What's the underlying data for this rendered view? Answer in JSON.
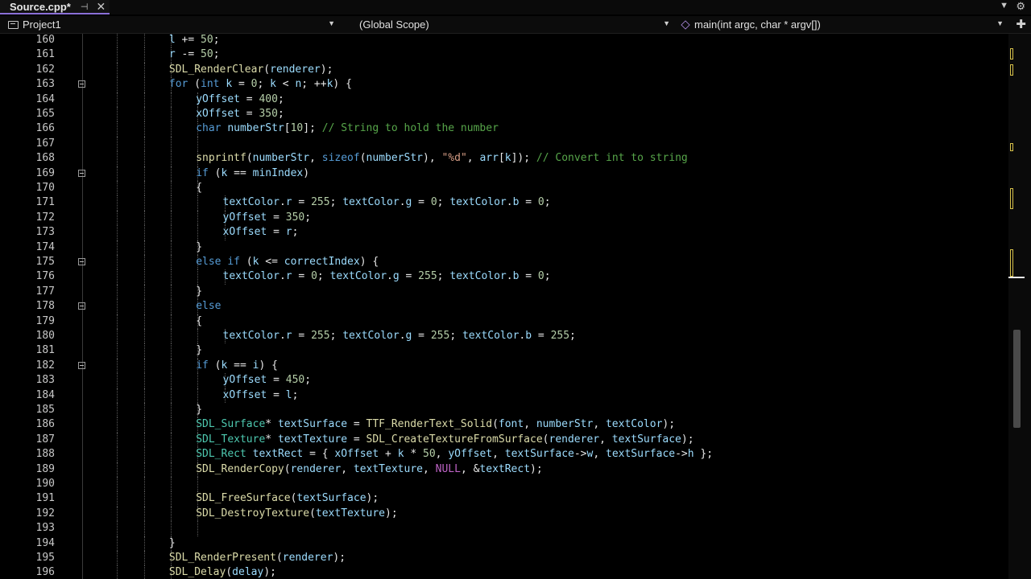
{
  "tab": {
    "title": "Source.cpp*",
    "pin_icon": "pin-icon",
    "close_icon": "close-icon"
  },
  "navbar": {
    "project": "Project1",
    "scope": "(Global Scope)",
    "function": "main(int argc, char * argv[])"
  },
  "colors": {
    "keyword": "#569cd6",
    "type": "#4ec9b0",
    "function": "#dcdcaa",
    "comment": "#57a64a",
    "string": "#d69d85",
    "number": "#b5cea8",
    "variable": "#9cdcfe",
    "macro": "#bd63c5",
    "plain": "#e6e6e6"
  },
  "lines": [
    {
      "n": "160",
      "indent": 4,
      "tokens": [
        [
          "v",
          "l"
        ],
        [
          "p",
          " += "
        ],
        [
          "num",
          "50"
        ],
        [
          "p",
          ";"
        ]
      ]
    },
    {
      "n": "161",
      "indent": 4,
      "tokens": [
        [
          "v",
          "r"
        ],
        [
          "p",
          " -= "
        ],
        [
          "num",
          "50"
        ],
        [
          "p",
          ";"
        ]
      ]
    },
    {
      "n": "162",
      "indent": 4,
      "tokens": [
        [
          "f",
          "SDL_RenderClear"
        ],
        [
          "p",
          "("
        ],
        [
          "v",
          "renderer"
        ],
        [
          "p",
          ");"
        ]
      ]
    },
    {
      "n": "163",
      "indent": 4,
      "fold": true,
      "tokens": [
        [
          "kw",
          "for"
        ],
        [
          "p",
          " ("
        ],
        [
          "kw",
          "int"
        ],
        [
          "p",
          " "
        ],
        [
          "v",
          "k"
        ],
        [
          "p",
          " = "
        ],
        [
          "num",
          "0"
        ],
        [
          "p",
          "; "
        ],
        [
          "v",
          "k"
        ],
        [
          "p",
          " < "
        ],
        [
          "v",
          "n"
        ],
        [
          "p",
          "; ++"
        ],
        [
          "v",
          "k"
        ],
        [
          "p",
          ") {"
        ]
      ]
    },
    {
      "n": "164",
      "indent": 5,
      "tokens": [
        [
          "v",
          "yOffset"
        ],
        [
          "p",
          " = "
        ],
        [
          "num",
          "400"
        ],
        [
          "p",
          ";"
        ]
      ]
    },
    {
      "n": "165",
      "indent": 5,
      "tokens": [
        [
          "v",
          "xOffset"
        ],
        [
          "p",
          " = "
        ],
        [
          "num",
          "350"
        ],
        [
          "p",
          ";"
        ]
      ]
    },
    {
      "n": "166",
      "indent": 5,
      "tokens": [
        [
          "kw",
          "char"
        ],
        [
          "p",
          " "
        ],
        [
          "v",
          "numberStr"
        ],
        [
          "p",
          "["
        ],
        [
          "num",
          "10"
        ],
        [
          "p",
          "]; "
        ],
        [
          "c",
          "// String to hold the number"
        ]
      ]
    },
    {
      "n": "167",
      "indent": 5,
      "tokens": []
    },
    {
      "n": "168",
      "indent": 5,
      "tokens": [
        [
          "f",
          "snprintf"
        ],
        [
          "p",
          "("
        ],
        [
          "v",
          "numberStr"
        ],
        [
          "p",
          ", "
        ],
        [
          "kw",
          "sizeof"
        ],
        [
          "p",
          "("
        ],
        [
          "v",
          "numberStr"
        ],
        [
          "p",
          "), "
        ],
        [
          "s",
          "\"%d\""
        ],
        [
          "p",
          ", "
        ],
        [
          "v",
          "arr"
        ],
        [
          "p",
          "["
        ],
        [
          "v",
          "k"
        ],
        [
          "p",
          "]); "
        ],
        [
          "c",
          "// Convert int to string"
        ]
      ]
    },
    {
      "n": "169",
      "indent": 5,
      "fold": true,
      "tokens": [
        [
          "kw",
          "if"
        ],
        [
          "p",
          " ("
        ],
        [
          "v",
          "k"
        ],
        [
          "p",
          " == "
        ],
        [
          "v",
          "minIndex"
        ],
        [
          "p",
          ")"
        ]
      ]
    },
    {
      "n": "170",
      "indent": 5,
      "tokens": [
        [
          "p",
          "{"
        ]
      ]
    },
    {
      "n": "171",
      "indent": 6,
      "tokens": [
        [
          "v",
          "textColor"
        ],
        [
          "p",
          "."
        ],
        [
          "v",
          "r"
        ],
        [
          "p",
          " = "
        ],
        [
          "num",
          "255"
        ],
        [
          "p",
          "; "
        ],
        [
          "v",
          "textColor"
        ],
        [
          "p",
          "."
        ],
        [
          "v",
          "g"
        ],
        [
          "p",
          " = "
        ],
        [
          "num",
          "0"
        ],
        [
          "p",
          "; "
        ],
        [
          "v",
          "textColor"
        ],
        [
          "p",
          "."
        ],
        [
          "v",
          "b"
        ],
        [
          "p",
          " = "
        ],
        [
          "num",
          "0"
        ],
        [
          "p",
          ";"
        ]
      ]
    },
    {
      "n": "172",
      "indent": 6,
      "tokens": [
        [
          "v",
          "yOffset"
        ],
        [
          "p",
          " = "
        ],
        [
          "num",
          "350"
        ],
        [
          "p",
          ";"
        ]
      ]
    },
    {
      "n": "173",
      "indent": 6,
      "tokens": [
        [
          "v",
          "xOffset"
        ],
        [
          "p",
          " = "
        ],
        [
          "v",
          "r"
        ],
        [
          "p",
          ";"
        ]
      ]
    },
    {
      "n": "174",
      "indent": 5,
      "tokens": [
        [
          "p",
          "}"
        ]
      ]
    },
    {
      "n": "175",
      "indent": 5,
      "fold": true,
      "tokens": [
        [
          "kw",
          "else if"
        ],
        [
          "p",
          " ("
        ],
        [
          "v",
          "k"
        ],
        [
          "p",
          " <= "
        ],
        [
          "v",
          "correctIndex"
        ],
        [
          "p",
          ") {"
        ]
      ]
    },
    {
      "n": "176",
      "indent": 6,
      "tokens": [
        [
          "v",
          "textColor"
        ],
        [
          "p",
          "."
        ],
        [
          "v",
          "r"
        ],
        [
          "p",
          " = "
        ],
        [
          "num",
          "0"
        ],
        [
          "p",
          "; "
        ],
        [
          "v",
          "textColor"
        ],
        [
          "p",
          "."
        ],
        [
          "v",
          "g"
        ],
        [
          "p",
          " = "
        ],
        [
          "num",
          "255"
        ],
        [
          "p",
          "; "
        ],
        [
          "v",
          "textColor"
        ],
        [
          "p",
          "."
        ],
        [
          "v",
          "b"
        ],
        [
          "p",
          " = "
        ],
        [
          "num",
          "0"
        ],
        [
          "p",
          ";"
        ]
      ]
    },
    {
      "n": "177",
      "indent": 5,
      "tokens": [
        [
          "p",
          "}"
        ]
      ]
    },
    {
      "n": "178",
      "indent": 5,
      "fold": true,
      "tokens": [
        [
          "kw",
          "else"
        ]
      ]
    },
    {
      "n": "179",
      "indent": 5,
      "tokens": [
        [
          "p",
          "{"
        ]
      ]
    },
    {
      "n": "180",
      "indent": 6,
      "tokens": [
        [
          "v",
          "textColor"
        ],
        [
          "p",
          "."
        ],
        [
          "v",
          "r"
        ],
        [
          "p",
          " = "
        ],
        [
          "num",
          "255"
        ],
        [
          "p",
          "; "
        ],
        [
          "v",
          "textColor"
        ],
        [
          "p",
          "."
        ],
        [
          "v",
          "g"
        ],
        [
          "p",
          " = "
        ],
        [
          "num",
          "255"
        ],
        [
          "p",
          "; "
        ],
        [
          "v",
          "textColor"
        ],
        [
          "p",
          "."
        ],
        [
          "v",
          "b"
        ],
        [
          "p",
          " = "
        ],
        [
          "num",
          "255"
        ],
        [
          "p",
          ";"
        ]
      ]
    },
    {
      "n": "181",
      "indent": 5,
      "tokens": [
        [
          "p",
          "}"
        ]
      ]
    },
    {
      "n": "182",
      "indent": 5,
      "fold": true,
      "tokens": [
        [
          "kw",
          "if"
        ],
        [
          "p",
          " ("
        ],
        [
          "v",
          "k"
        ],
        [
          "p",
          " == "
        ],
        [
          "v",
          "i"
        ],
        [
          "p",
          ") {"
        ]
      ]
    },
    {
      "n": "183",
      "indent": 6,
      "tokens": [
        [
          "v",
          "yOffset"
        ],
        [
          "p",
          " = "
        ],
        [
          "num",
          "450"
        ],
        [
          "p",
          ";"
        ]
      ]
    },
    {
      "n": "184",
      "indent": 6,
      "tokens": [
        [
          "v",
          "xOffset"
        ],
        [
          "p",
          " = "
        ],
        [
          "v",
          "l"
        ],
        [
          "p",
          ";"
        ]
      ]
    },
    {
      "n": "185",
      "indent": 5,
      "tokens": [
        [
          "p",
          "}"
        ]
      ]
    },
    {
      "n": "186",
      "indent": 5,
      "tokens": [
        [
          "t",
          "SDL_Surface"
        ],
        [
          "p",
          "* "
        ],
        [
          "v",
          "textSurface"
        ],
        [
          "p",
          " = "
        ],
        [
          "f",
          "TTF_RenderText_Solid"
        ],
        [
          "p",
          "("
        ],
        [
          "v",
          "font"
        ],
        [
          "p",
          ", "
        ],
        [
          "v",
          "numberStr"
        ],
        [
          "p",
          ", "
        ],
        [
          "v",
          "textColor"
        ],
        [
          "p",
          ");"
        ]
      ]
    },
    {
      "n": "187",
      "indent": 5,
      "tokens": [
        [
          "t",
          "SDL_Texture"
        ],
        [
          "p",
          "* "
        ],
        [
          "v",
          "textTexture"
        ],
        [
          "p",
          " = "
        ],
        [
          "f",
          "SDL_CreateTextureFromSurface"
        ],
        [
          "p",
          "("
        ],
        [
          "v",
          "renderer"
        ],
        [
          "p",
          ", "
        ],
        [
          "v",
          "textSurface"
        ],
        [
          "p",
          ");"
        ]
      ]
    },
    {
      "n": "188",
      "indent": 5,
      "tokens": [
        [
          "t",
          "SDL_Rect"
        ],
        [
          "p",
          " "
        ],
        [
          "v",
          "textRect"
        ],
        [
          "p",
          " = { "
        ],
        [
          "v",
          "xOffset"
        ],
        [
          "p",
          " + "
        ],
        [
          "v",
          "k"
        ],
        [
          "p",
          " * "
        ],
        [
          "num",
          "50"
        ],
        [
          "p",
          ", "
        ],
        [
          "v",
          "yOffset"
        ],
        [
          "p",
          ", "
        ],
        [
          "v",
          "textSurface"
        ],
        [
          "p",
          "->"
        ],
        [
          "v",
          "w"
        ],
        [
          "p",
          ", "
        ],
        [
          "v",
          "textSurface"
        ],
        [
          "p",
          "->"
        ],
        [
          "v",
          "h"
        ],
        [
          "p",
          " };"
        ]
      ]
    },
    {
      "n": "189",
      "indent": 5,
      "tokens": [
        [
          "f",
          "SDL_RenderCopy"
        ],
        [
          "p",
          "("
        ],
        [
          "v",
          "renderer"
        ],
        [
          "p",
          ", "
        ],
        [
          "v",
          "textTexture"
        ],
        [
          "p",
          ", "
        ],
        [
          "m",
          "NULL"
        ],
        [
          "p",
          ", &"
        ],
        [
          "v",
          "textRect"
        ],
        [
          "p",
          ");"
        ]
      ]
    },
    {
      "n": "190",
      "indent": 5,
      "tokens": []
    },
    {
      "n": "191",
      "indent": 5,
      "tokens": [
        [
          "f",
          "SDL_FreeSurface"
        ],
        [
          "p",
          "("
        ],
        [
          "v",
          "textSurface"
        ],
        [
          "p",
          ");"
        ]
      ]
    },
    {
      "n": "192",
      "indent": 5,
      "tokens": [
        [
          "f",
          "SDL_DestroyTexture"
        ],
        [
          "p",
          "("
        ],
        [
          "v",
          "textTexture"
        ],
        [
          "p",
          ");"
        ]
      ]
    },
    {
      "n": "193",
      "indent": 5,
      "tokens": []
    },
    {
      "n": "194",
      "indent": 4,
      "tokens": [
        [
          "p",
          "}"
        ]
      ]
    },
    {
      "n": "195",
      "indent": 4,
      "tokens": [
        [
          "f",
          "SDL_RenderPresent"
        ],
        [
          "p",
          "("
        ],
        [
          "v",
          "renderer"
        ],
        [
          "p",
          ");"
        ]
      ]
    },
    {
      "n": "196",
      "indent": 4,
      "tokens": [
        [
          "f",
          "SDL_Delay"
        ],
        [
          "p",
          "("
        ],
        [
          "v",
          "delay"
        ],
        [
          "p",
          ");"
        ]
      ]
    }
  ]
}
